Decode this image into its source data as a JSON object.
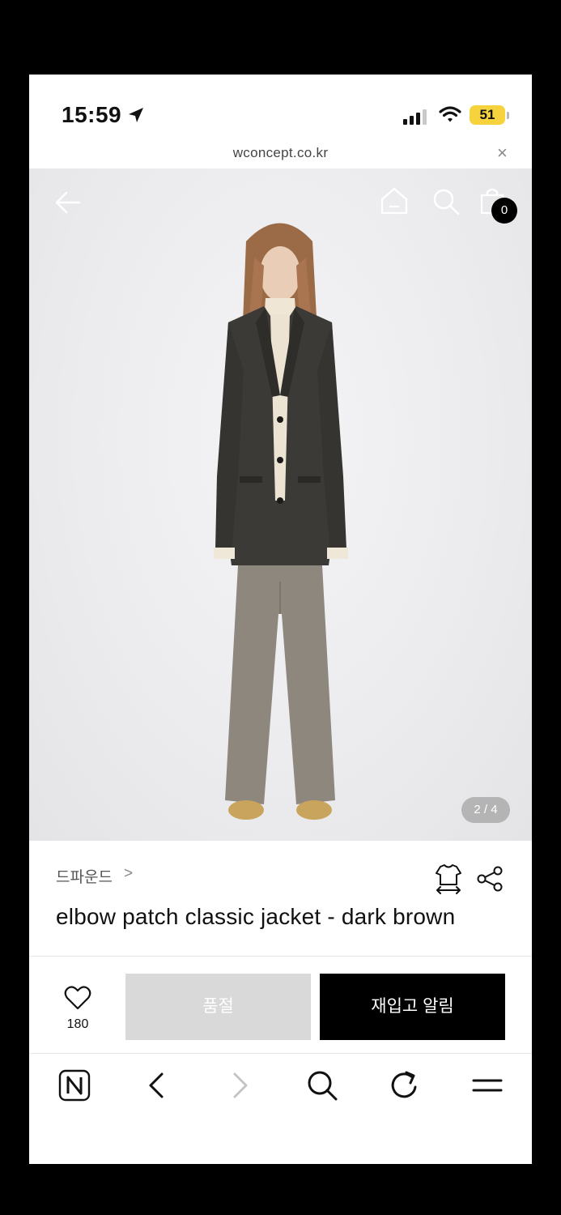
{
  "status_bar": {
    "time": "15:59",
    "battery": "51"
  },
  "browser": {
    "url": "wconcept.co.kr",
    "close_label": "×"
  },
  "product": {
    "cart_count": "0",
    "image_counter": "2 / 4",
    "brand": "드파운드",
    "brand_chevron": ">",
    "title": "elbow patch classic jacket - dark brown"
  },
  "actions": {
    "wishlist_count": "180",
    "soldout_label": "품절",
    "restock_label": "재입고 알림"
  },
  "icons": {
    "back": "back-arrow-icon",
    "home": "home-icon",
    "search": "search-icon",
    "bag": "shopping-bag-icon",
    "size": "size-guide-icon",
    "share": "share-icon",
    "heart": "heart-icon"
  },
  "colors": {
    "battery": "#f6d23d",
    "primary_button": "#000000",
    "disabled_button": "#d9d9d9"
  }
}
